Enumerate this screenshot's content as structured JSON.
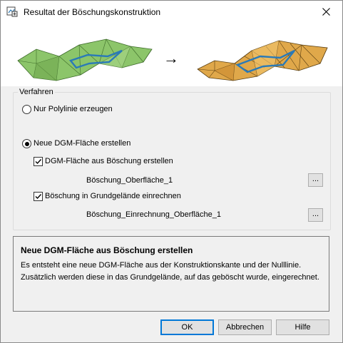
{
  "window": {
    "title": "Resultat der Böschungskonstruktion",
    "icon": "app-dialog-icon",
    "close_icon": "close-icon"
  },
  "hero": {
    "arrow": "→",
    "left_image": "green-terrain-mesh",
    "right_image": "orange-terrain-mesh"
  },
  "procedure": {
    "title": "Verfahren",
    "option_polyline": {
      "label": "Nur Polylinie erzeugen",
      "selected": false
    },
    "option_dgm": {
      "label": "Neue DGM-Fläche erstellen",
      "selected": true
    },
    "check_slope": {
      "label": "DGM-Fläche aus Böschung erstellen",
      "checked": true,
      "surface_name": "Böschung_Oberfläche_1",
      "browse_label": "..."
    },
    "check_terrain": {
      "label": "Böschung in Grundgelände einrechnen",
      "checked": true,
      "surface_name": "Böschung_Einrechnung_Oberfläche_1",
      "browse_label": "..."
    }
  },
  "info": {
    "title": "Neue DGM-Fläche aus Böschung erstellen",
    "body": "Es entsteht eine neue DGM-Fläche aus der Konstruktionskante und der Nulllinie. Zusätzlich werden diese in das Grundgelände, auf das geböscht wurde, eingerechnet."
  },
  "buttons": {
    "ok": "OK",
    "cancel": "Abbrechen",
    "help": "Hilfe"
  },
  "colors": {
    "accent": "#0078d7",
    "green_mesh": "#8cc56a",
    "orange_mesh": "#e0a84a",
    "polyline": "#2a7ab8"
  }
}
